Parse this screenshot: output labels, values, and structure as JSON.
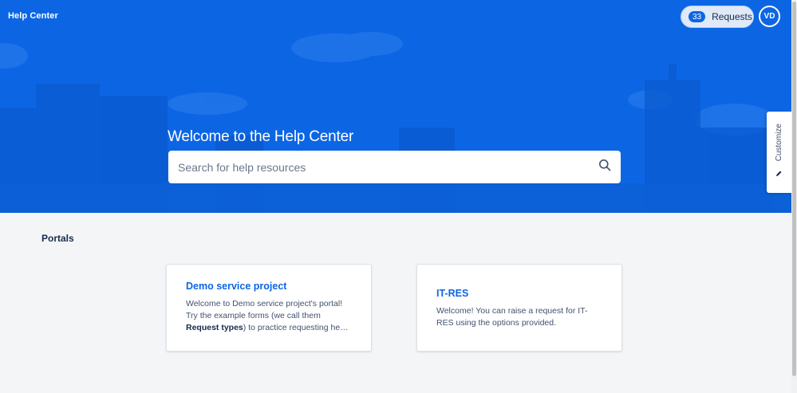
{
  "header": {
    "brand": "Help Center",
    "requests": {
      "count": "33",
      "label": "Requests"
    },
    "avatar_initials": "VD"
  },
  "hero": {
    "title": "Welcome to the Help Center",
    "search_placeholder": "Search for help resources",
    "search_icon": "search-icon"
  },
  "customize": {
    "label": "Customize",
    "icon": "pencil-icon"
  },
  "portals": {
    "heading": "Portals",
    "cards": [
      {
        "title": "Demo service project",
        "desc_pre": "Welcome to Demo service project's portal! Try the example forms (we call them ",
        "desc_bold": "Request types",
        "desc_post": ") to practice requesting he…"
      },
      {
        "title": "IT-RES",
        "desc": "Welcome! You can raise a request for IT-RES using the options provided."
      }
    ]
  },
  "colors": {
    "hero_blue": "#0c66e4",
    "link_blue": "#0c66e4",
    "page_bg": "#f4f5f7",
    "text_dark": "#172b4d"
  }
}
